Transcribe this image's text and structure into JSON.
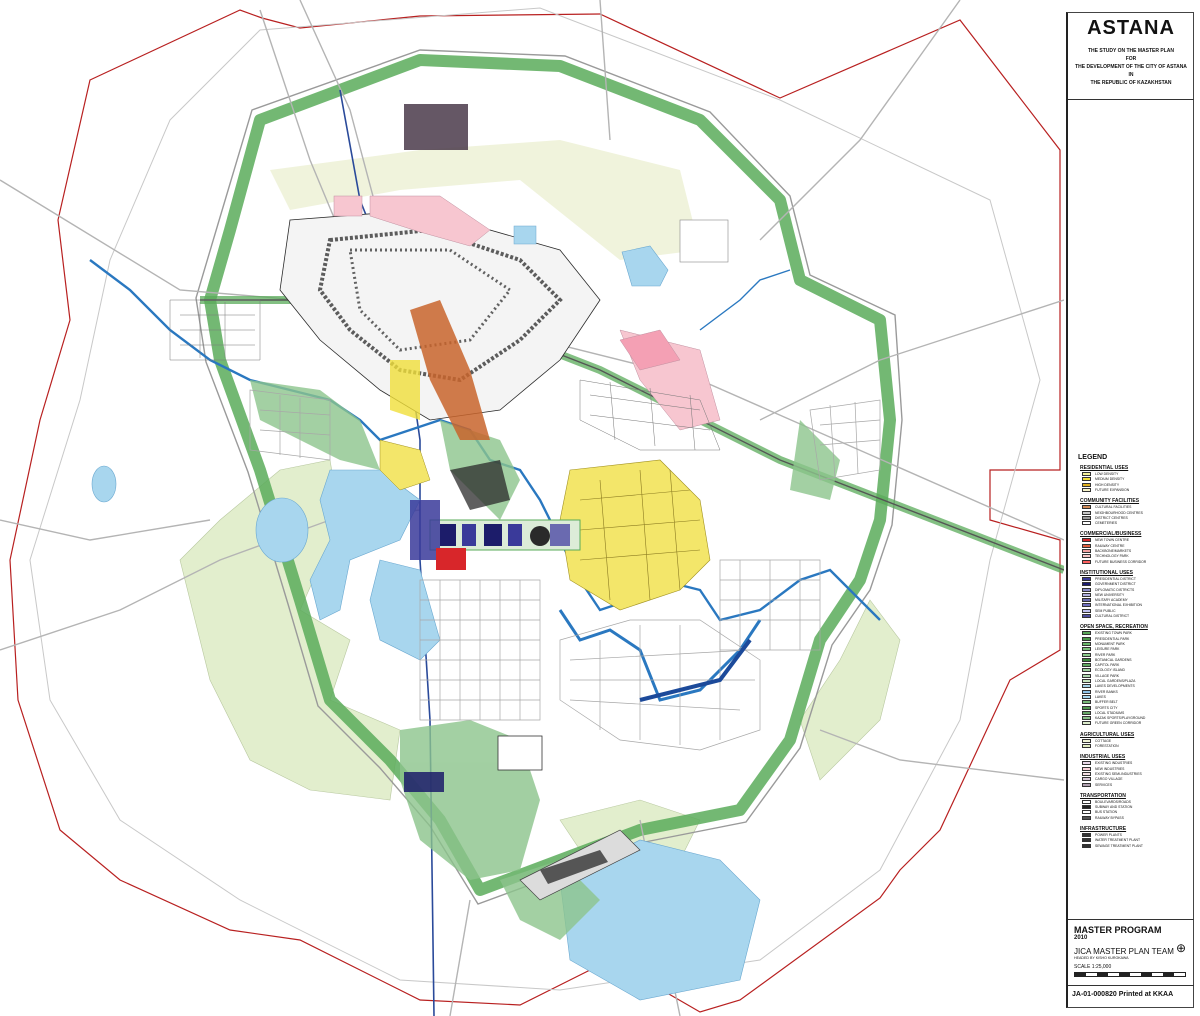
{
  "title": "ASTANA",
  "subtitle_lines": [
    "THE STUDY ON THE MASTER PLAN",
    "FOR",
    "THE DEVELOPMENT OF THE CITY OF ASTANA",
    "IN",
    "THE REPUBLIC OF KAZAKHSTAN"
  ],
  "legend": {
    "title": "LEGEND",
    "sections": [
      {
        "name": "RESIDENTIAL USES",
        "items": [
          {
            "label": "LOW DENSITY",
            "color": "#f3f09a"
          },
          {
            "label": "MEDIUM DENSITY",
            "color": "#f0de3a"
          },
          {
            "label": "HIGH DENSITY",
            "color": "#e0b020"
          },
          {
            "label": "FUTURE EXPANSION",
            "color": "#f7f3c8"
          }
        ]
      },
      {
        "name": "COMMUNITY FACILITIES",
        "items": [
          {
            "label": "CULTURAL FACILITIES",
            "color": "#d28c5a"
          },
          {
            "label": "NEIGHBOURHOOD CENTRES",
            "color": "#c8c8c8"
          },
          {
            "label": "DISTRICT CENTRES",
            "color": "#9a9a9a"
          },
          {
            "label": "CEMETERIES",
            "color": "#ffffff"
          }
        ]
      },
      {
        "name": "COMMERCIAL/BUSINESS",
        "items": [
          {
            "label": "NEW TOWN CENTRE",
            "color": "#d8262a"
          },
          {
            "label": "RAILWAY CENTRE",
            "color": "#e06040"
          },
          {
            "label": "BACKBONE/MARKETS",
            "color": "#f0a0a0"
          },
          {
            "label": "TECHNOLOGY PARK",
            "color": "#f7c8c8"
          },
          {
            "label": "FUTURE BUSINESS CORRIDOR",
            "color": "#ff6060"
          }
        ]
      },
      {
        "name": "INSTITUTIONAL USES",
        "items": [
          {
            "label": "PRESIDENTIAL DISTRICT",
            "color": "#3a3a9a"
          },
          {
            "label": "GOVERNMENT DISTRICT",
            "color": "#1a1a70"
          },
          {
            "label": "DIPLOMATIC DISTRICTS",
            "color": "#8a8ac8"
          },
          {
            "label": "NEW UNIVERSITY",
            "color": "#b0b0e0"
          },
          {
            "label": "MILITARY ACADEMY",
            "color": "#6a6ab0"
          },
          {
            "label": "INTERNATIONAL EXHIBITION",
            "color": "#7070c0"
          },
          {
            "label": "SEM PUBLIC",
            "color": "#c0c0ee"
          },
          {
            "label": "CULTURAL DISTRICT",
            "color": "#5050a0"
          }
        ]
      },
      {
        "name": "OPEN SPACE, RECREATION",
        "items": [
          {
            "label": "EXISTING TOWN PARK",
            "color": "#5aa85a"
          },
          {
            "label": "PRESIDENTIAL PARK",
            "color": "#4a984a"
          },
          {
            "label": "MONUMENT PARK",
            "color": "#6ab86a"
          },
          {
            "label": "LEISURE PARK",
            "color": "#7ac07a"
          },
          {
            "label": "RIVER PARK",
            "color": "#8ccc8c"
          },
          {
            "label": "BOTANICAL GARDENS",
            "color": "#3a8a3a"
          },
          {
            "label": "CAPITOL PARK",
            "color": "#60a860"
          },
          {
            "label": "ECOLOGY ISLAND",
            "color": "#9ed09e"
          },
          {
            "label": "VILLAGE PARK",
            "color": "#b0d8b0"
          },
          {
            "label": "LOCAL GARDENS/PLAZA",
            "color": "#c8e4c0"
          },
          {
            "label": "LAKES DEVELOPMENTS",
            "color": "#a8d4ec"
          },
          {
            "label": "RIVER BANKS",
            "color": "#90c4e8"
          },
          {
            "label": "LAKES",
            "color": "#a8d8f0"
          },
          {
            "label": "BUFFER BELT",
            "color": "#78b878"
          },
          {
            "label": "SPORTS CITY",
            "color": "#509850"
          },
          {
            "label": "LOCAL STADIUMS",
            "color": "#68a868"
          },
          {
            "label": "KAZAK SPORTS/PLAYGROUND",
            "color": "#88c088"
          },
          {
            "label": "FUTURE GREEN CORRIDOR",
            "color": "#dceccc"
          }
        ]
      },
      {
        "name": "AGRICULTURAL USES",
        "items": [
          {
            "label": "COTTAGE",
            "color": "#f0f4d8"
          },
          {
            "label": "FORESTATION",
            "color": "#e4eec4"
          }
        ]
      },
      {
        "name": "INDUSTRIAL USES",
        "items": [
          {
            "label": "EXISTING INDUSTRIES",
            "color": "#e8d8e8"
          },
          {
            "label": "NEW INDUSTRIES",
            "color": "#f8d0d8"
          },
          {
            "label": "EXISTING SEMI-INDUSTRIES",
            "color": "#f4e0e4"
          },
          {
            "label": "CARGO VILLAGE",
            "color": "#d8c8d8"
          },
          {
            "label": "SERVICES",
            "color": "#b0a0b0"
          }
        ]
      },
      {
        "name": "TRANSPORTATION",
        "items": [
          {
            "label": "BOULEVARDS/ROADS",
            "color": "#ffffff"
          },
          {
            "label": "SUBWAY AND STATION",
            "color": "#222222"
          },
          {
            "label": "BUS STATION",
            "color": "#ffffff"
          },
          {
            "label": "RAILWAY BYPASS",
            "color": "#555555"
          }
        ]
      },
      {
        "name": "INFRASTRUCTURE",
        "items": [
          {
            "label": "POWER PLANTS",
            "color": "#333333"
          },
          {
            "label": "WATER TREATMENT PLANT",
            "color": "#333333"
          },
          {
            "label": "SEWAGE TREATMENT PLANT",
            "color": "#333333"
          }
        ]
      }
    ]
  },
  "title_block": {
    "program": "MASTER PROGRAM",
    "year": "2010",
    "team": "JICA MASTER PLAN TEAM",
    "headed_by": "HEADED BY KISHO KUROKAWA",
    "scale": "SCALE 1:25,000",
    "document_no": "JA-01-000820 Printed at KKAA"
  },
  "colors": {
    "green_belt": "#5aab5a",
    "park_green": "#8cc48c",
    "light_green": "#e2eecd",
    "water": "#a8d6ee",
    "river": "#2a78c0",
    "residential_yellow": "#f3e66a",
    "industrial_pink": "#f7c6d0",
    "commercial_red": "#d8262a",
    "institutional_navy": "#1c1c6a",
    "admin_border": "#b82020",
    "dense_urban": "#2a2a2a"
  }
}
